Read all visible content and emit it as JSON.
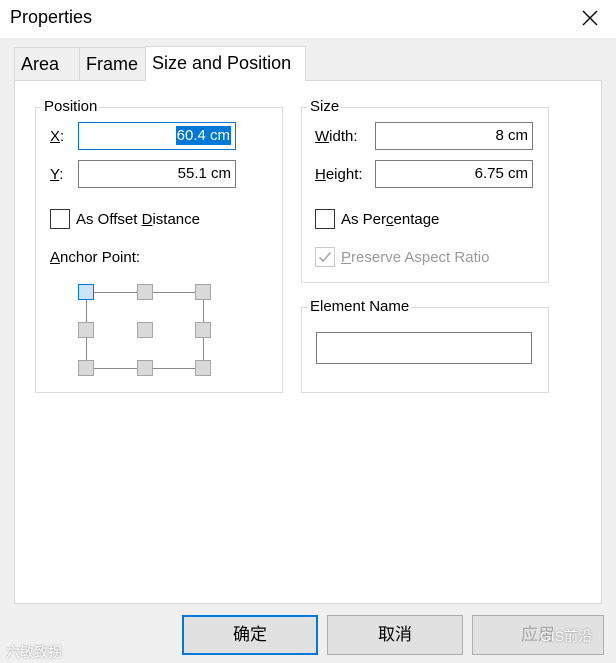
{
  "window": {
    "title": "Properties",
    "close_icon": "close-icon"
  },
  "tabs": [
    {
      "label": "Area",
      "active": false
    },
    {
      "label": "Frame",
      "active": false
    },
    {
      "label": "Size and Position",
      "active": true
    }
  ],
  "position": {
    "title": "Position",
    "x_label_key": "X",
    "x_label_rest": ":",
    "x_value": "60.4 cm",
    "y_label_key": "Y",
    "y_label_rest": ":",
    "y_value": "55.1 cm",
    "offset_pre": "As Offset ",
    "offset_key": "D",
    "offset_post": "istance",
    "offset_checked": false,
    "anchor_key": "A",
    "anchor_rest": "nchor Point:",
    "anchor_selected": "top-left"
  },
  "size": {
    "title": "Size",
    "width_key": "W",
    "width_rest": "idth:",
    "width_value": "8 cm",
    "height_key": "H",
    "height_rest": "eight:",
    "height_value": "6.75 cm",
    "percentage_pre": "As Per",
    "percentage_key": "c",
    "percentage_post": "entage",
    "percentage_checked": false,
    "aspect_key": "P",
    "aspect_rest": "reserve Aspect Ratio",
    "aspect_checked": true,
    "aspect_enabled": false
  },
  "element_name": {
    "title": "Element Name",
    "value": ""
  },
  "buttons": {
    "ok": "确定",
    "cancel": "取消",
    "apply": "应用"
  },
  "watermarks": {
    "left": "六敏致拐",
    "right": "GIS前沿"
  },
  "colors": {
    "accent": "#0078d7",
    "dialog_bg": "#f0f0f0",
    "panel_bg": "#ffffff"
  }
}
